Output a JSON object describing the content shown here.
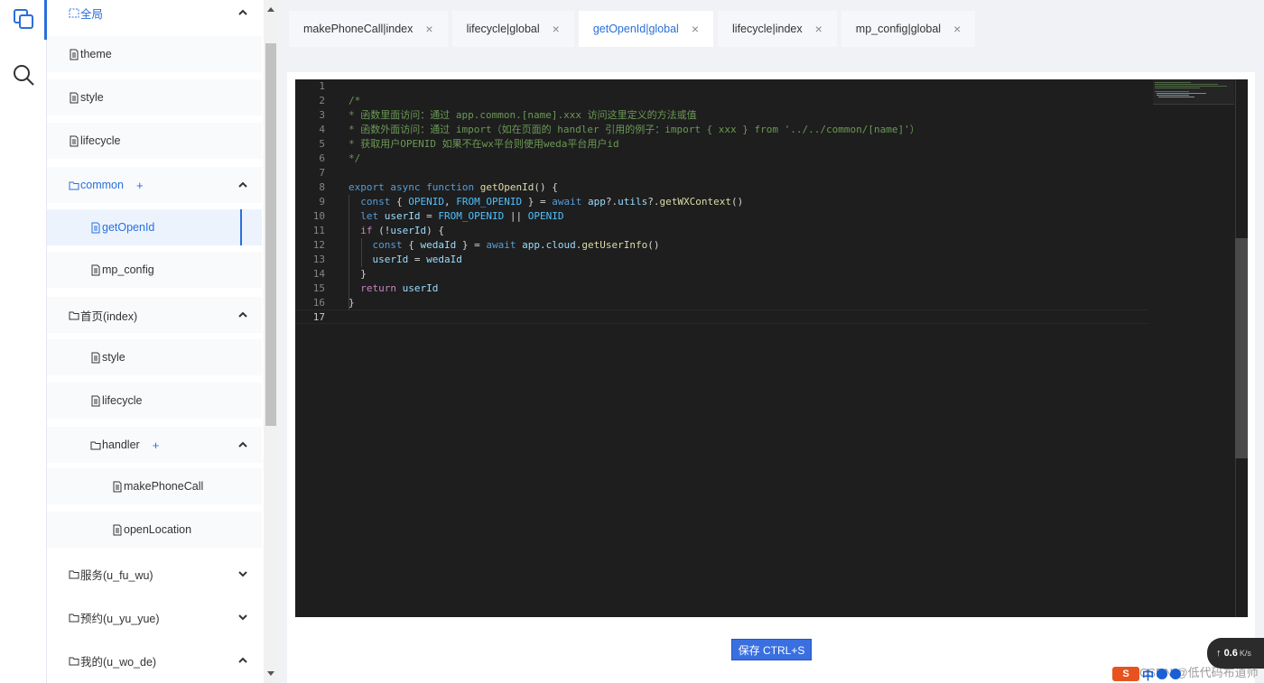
{
  "rail": {
    "icons": [
      "copy-icon",
      "search-icon"
    ]
  },
  "tree": {
    "items": [
      {
        "label": "全局",
        "kind": "folder-dashed",
        "expanded": true
      },
      {
        "label": "theme",
        "kind": "file"
      },
      {
        "label": "style",
        "kind": "file"
      },
      {
        "label": "lifecycle",
        "kind": "file"
      },
      {
        "label": "common",
        "kind": "folder",
        "add": "+",
        "expanded": true
      },
      {
        "label": "getOpenId",
        "kind": "file",
        "selected": true
      },
      {
        "label": "mp_config",
        "kind": "file"
      },
      {
        "label": "首页(index)",
        "kind": "folder",
        "expanded": true
      },
      {
        "label": "style",
        "kind": "file"
      },
      {
        "label": "lifecycle",
        "kind": "file"
      },
      {
        "label": "handler",
        "kind": "folder",
        "add": "+",
        "expanded": true
      },
      {
        "label": "makePhoneCall",
        "kind": "file"
      },
      {
        "label": "openLocation",
        "kind": "file"
      },
      {
        "label": "服务(u_fu_wu)",
        "kind": "folder",
        "expanded": false
      },
      {
        "label": "预约(u_yu_yue)",
        "kind": "folder",
        "expanded": false
      },
      {
        "label": "我的(u_wo_de)",
        "kind": "folder",
        "expanded": true
      }
    ]
  },
  "tabs": [
    {
      "label": "makePhoneCall|index",
      "close": "×"
    },
    {
      "label": "lifecycle|global",
      "close": "×"
    },
    {
      "label": "getOpenId|global",
      "close": "×",
      "active": true
    },
    {
      "label": "lifecycle|index",
      "close": "×"
    },
    {
      "label": "mp_config|global",
      "close": "×"
    }
  ],
  "editor": {
    "line_numbers": [
      "1",
      "2",
      "3",
      "4",
      "5",
      "6",
      "7",
      "8",
      "9",
      "10",
      "11",
      "12",
      "13",
      "14",
      "15",
      "16",
      "17"
    ],
    "current_line": "17",
    "lines": [
      "",
      "/*",
      "* 函数里面访问：通过 app.common.[name].xxx 访问这里定义的方法或值",
      "* 函数外面访问：通过 import（如在页面的 handler 引用的例子：import { xxx } from '../../common/[name]'）",
      "* 获取用户OPENID 如果不在wx平台则使用weda平台用户id",
      "*/",
      "",
      "export async function getOpenId() {",
      "  const { OPENID, FROM_OPENID } = await app?.utils?.getWXContext()",
      "  let userId = FROM_OPENID || OPENID",
      "  if (!userId) {",
      "    const { wedaId } = await app.cloud.getUserInfo()",
      "    userId = wedaId",
      "  }",
      "  return userId",
      "}",
      ""
    ]
  },
  "save_button": "保存 CTRL+S",
  "network_speed": {
    "value": "0.6",
    "unit": "K/s"
  },
  "ime": {
    "brand": "S",
    "mode": "中"
  },
  "watermark": "CSDN @低代码布道师",
  "colors": {
    "accent": "#2a6fdb",
    "editor_bg": "#1e1e1e",
    "button": "#3a6fe0"
  }
}
